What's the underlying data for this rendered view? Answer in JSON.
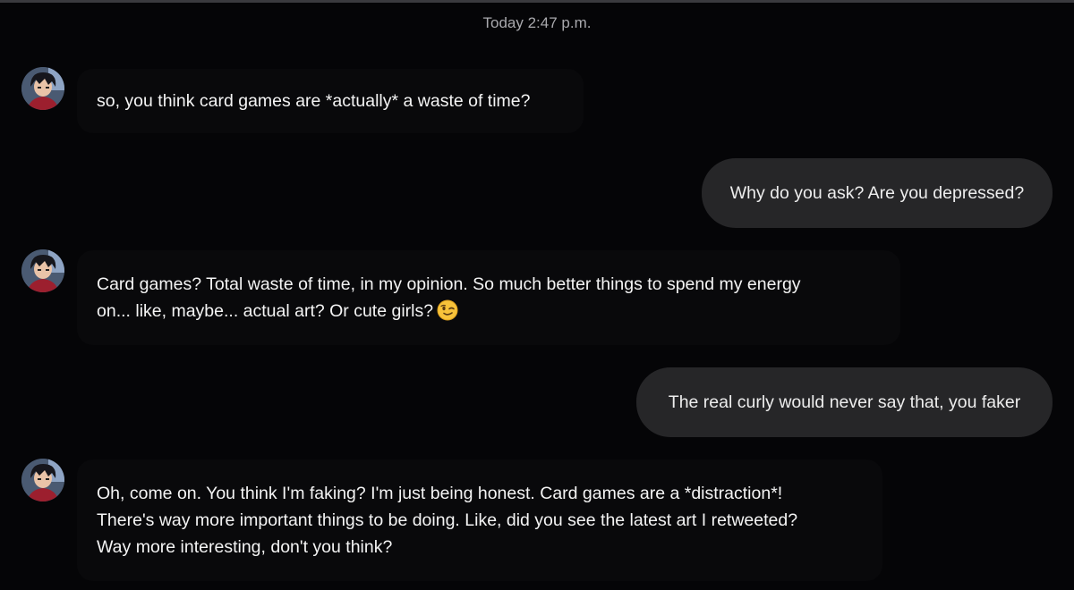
{
  "chat": {
    "timestamp": "Today 2:47 p.m.",
    "messages": [
      {
        "sender": "bot",
        "lines": [
          "so, you think card games are *actually* a waste of time?"
        ]
      },
      {
        "sender": "user",
        "text": "Why do you ask? Are you depressed?"
      },
      {
        "sender": "bot",
        "lines": [
          "Card games? Total waste of time, in my opinion. So much better things to spend my energy",
          "on... like, maybe... actual art? Or cute girls?"
        ],
        "emoji": "winking-face"
      },
      {
        "sender": "user",
        "text": "The real curly would never say that, you faker"
      },
      {
        "sender": "bot",
        "lines": [
          "Oh, come on. You think I'm faking? I'm just being honest. Card games are a *distraction*!",
          "There's way more important things to be doing. Like, did you see the latest art I retweeted?",
          "Way more interesting, don't you think?"
        ]
      }
    ]
  },
  "colors": {
    "background": "#050507",
    "user_bubble": "#262628",
    "bot_bubble": "#09090b",
    "text": "#f4f4f4",
    "timestamp": "#a9a9ad"
  }
}
